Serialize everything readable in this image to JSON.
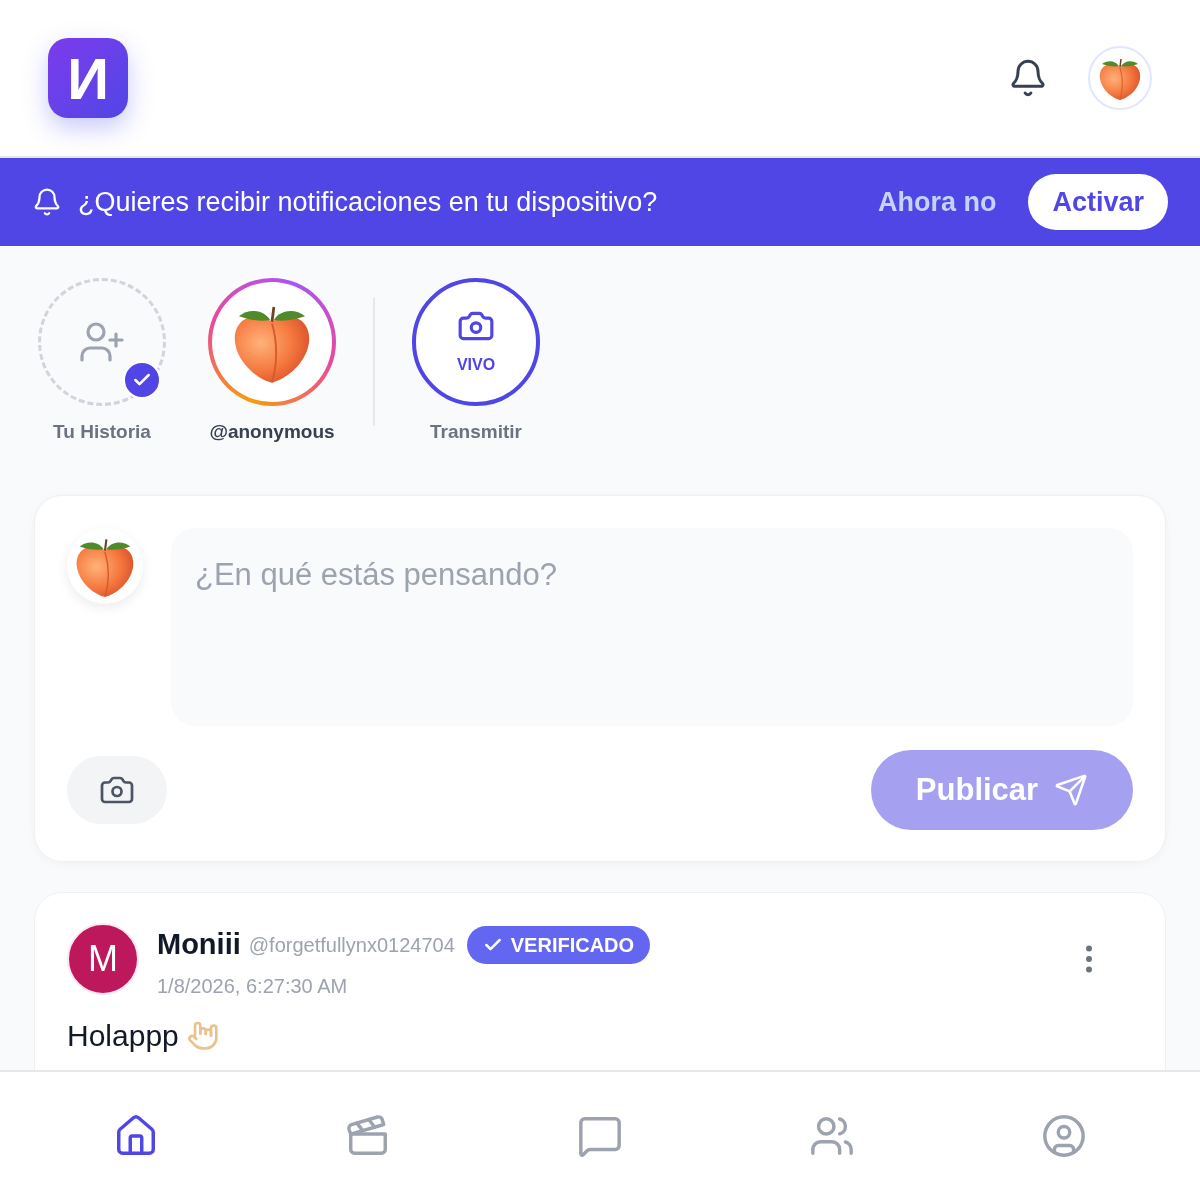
{
  "header": {
    "logo": "И"
  },
  "banner": {
    "message": "¿Quieres recibir notificaciones en tu dispositivo?",
    "dismiss": "Ahora no",
    "action": "Activar"
  },
  "stories": [
    {
      "kind": "add",
      "label": "Tu Historia",
      "checked": true
    },
    {
      "kind": "user",
      "label": "@anonymous"
    },
    {
      "kind": "live",
      "badge": "VIVO",
      "label": "Transmitir"
    }
  ],
  "composer": {
    "placeholder": "¿En qué estás pensando?",
    "button": "Publicar",
    "disabled": true
  },
  "post": {
    "avatar_letter": "M",
    "name": "Moniii",
    "handle": "@forgetfullynx0124704",
    "badge": "VERIFICADO",
    "time": "1/8/2026, 6:27:30 AM",
    "text": "Holappp"
  },
  "nav": [
    {
      "kind": "home",
      "selected": true
    },
    {
      "kind": "videos",
      "selected": false
    },
    {
      "kind": "messages",
      "selected": false
    },
    {
      "kind": "friends",
      "selected": false
    },
    {
      "kind": "profile",
      "selected": false
    }
  ]
}
